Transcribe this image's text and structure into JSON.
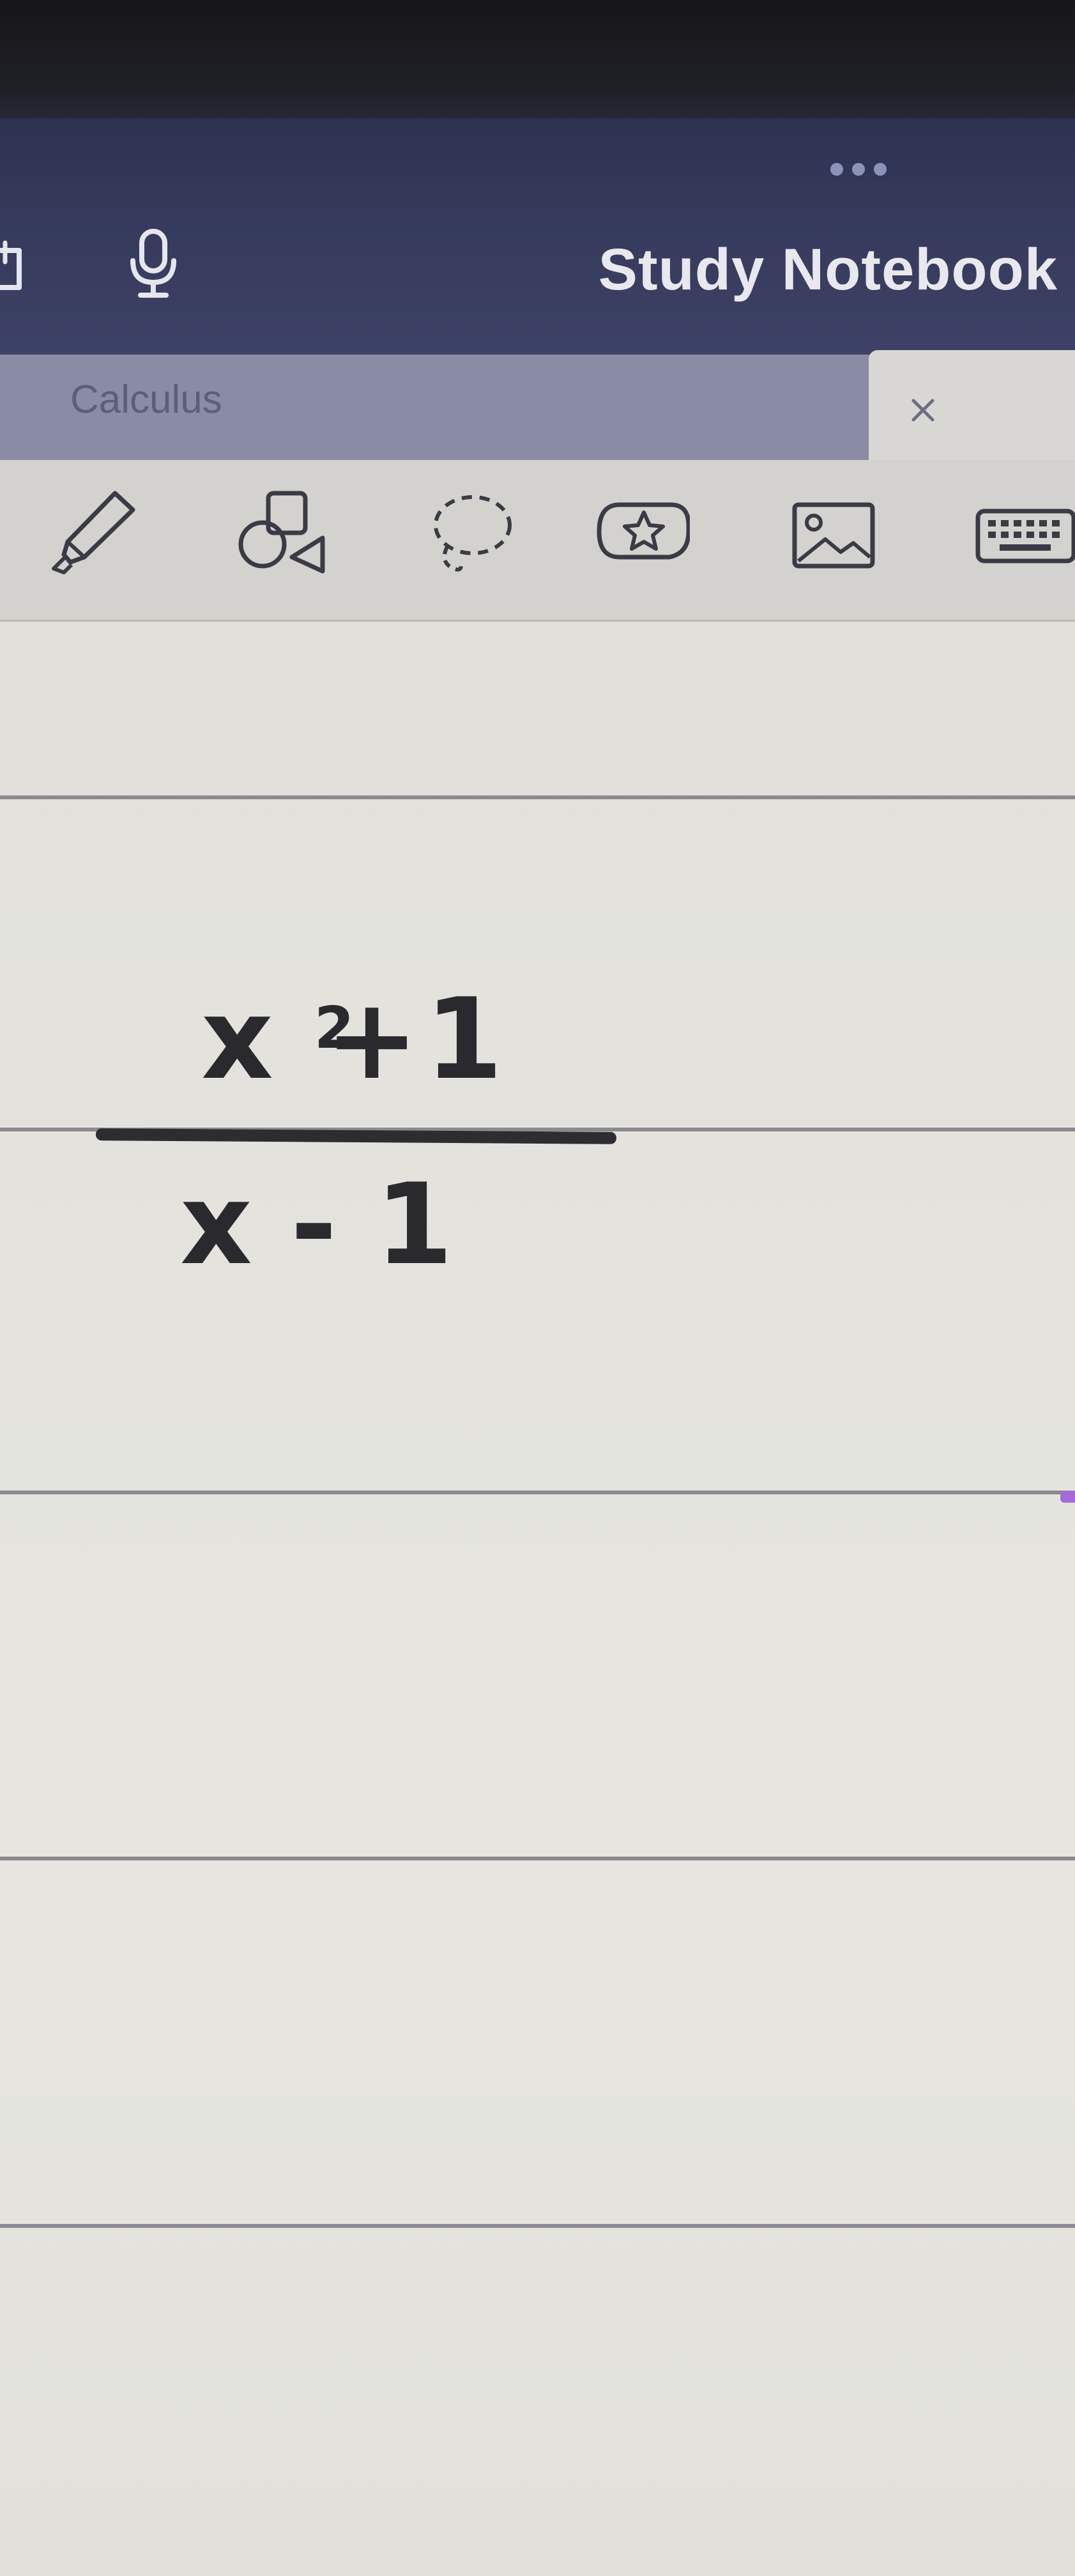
{
  "app": {
    "title": "Study Notebook"
  },
  "tabs": {
    "section_label": "Calculus",
    "close_glyph": "×"
  },
  "toolbar": {
    "tools": [
      {
        "icon": "highlighter-icon"
      },
      {
        "icon": "shapes-icon"
      },
      {
        "icon": "lasso-icon"
      },
      {
        "icon": "sticker-icon"
      },
      {
        "icon": "image-icon"
      },
      {
        "icon": "keyboard-icon"
      }
    ]
  },
  "note": {
    "numerator": "x  +1",
    "exponent": "2",
    "denominator": "x-1"
  },
  "colors": {
    "title_bar": "#363b5d",
    "tab_strip": "#8a8ca5",
    "toolbar": "#d3d2ce",
    "paper": "#e3e2dc",
    "ink": "#2a2a2e",
    "margin_accent": "#a56ad8"
  }
}
